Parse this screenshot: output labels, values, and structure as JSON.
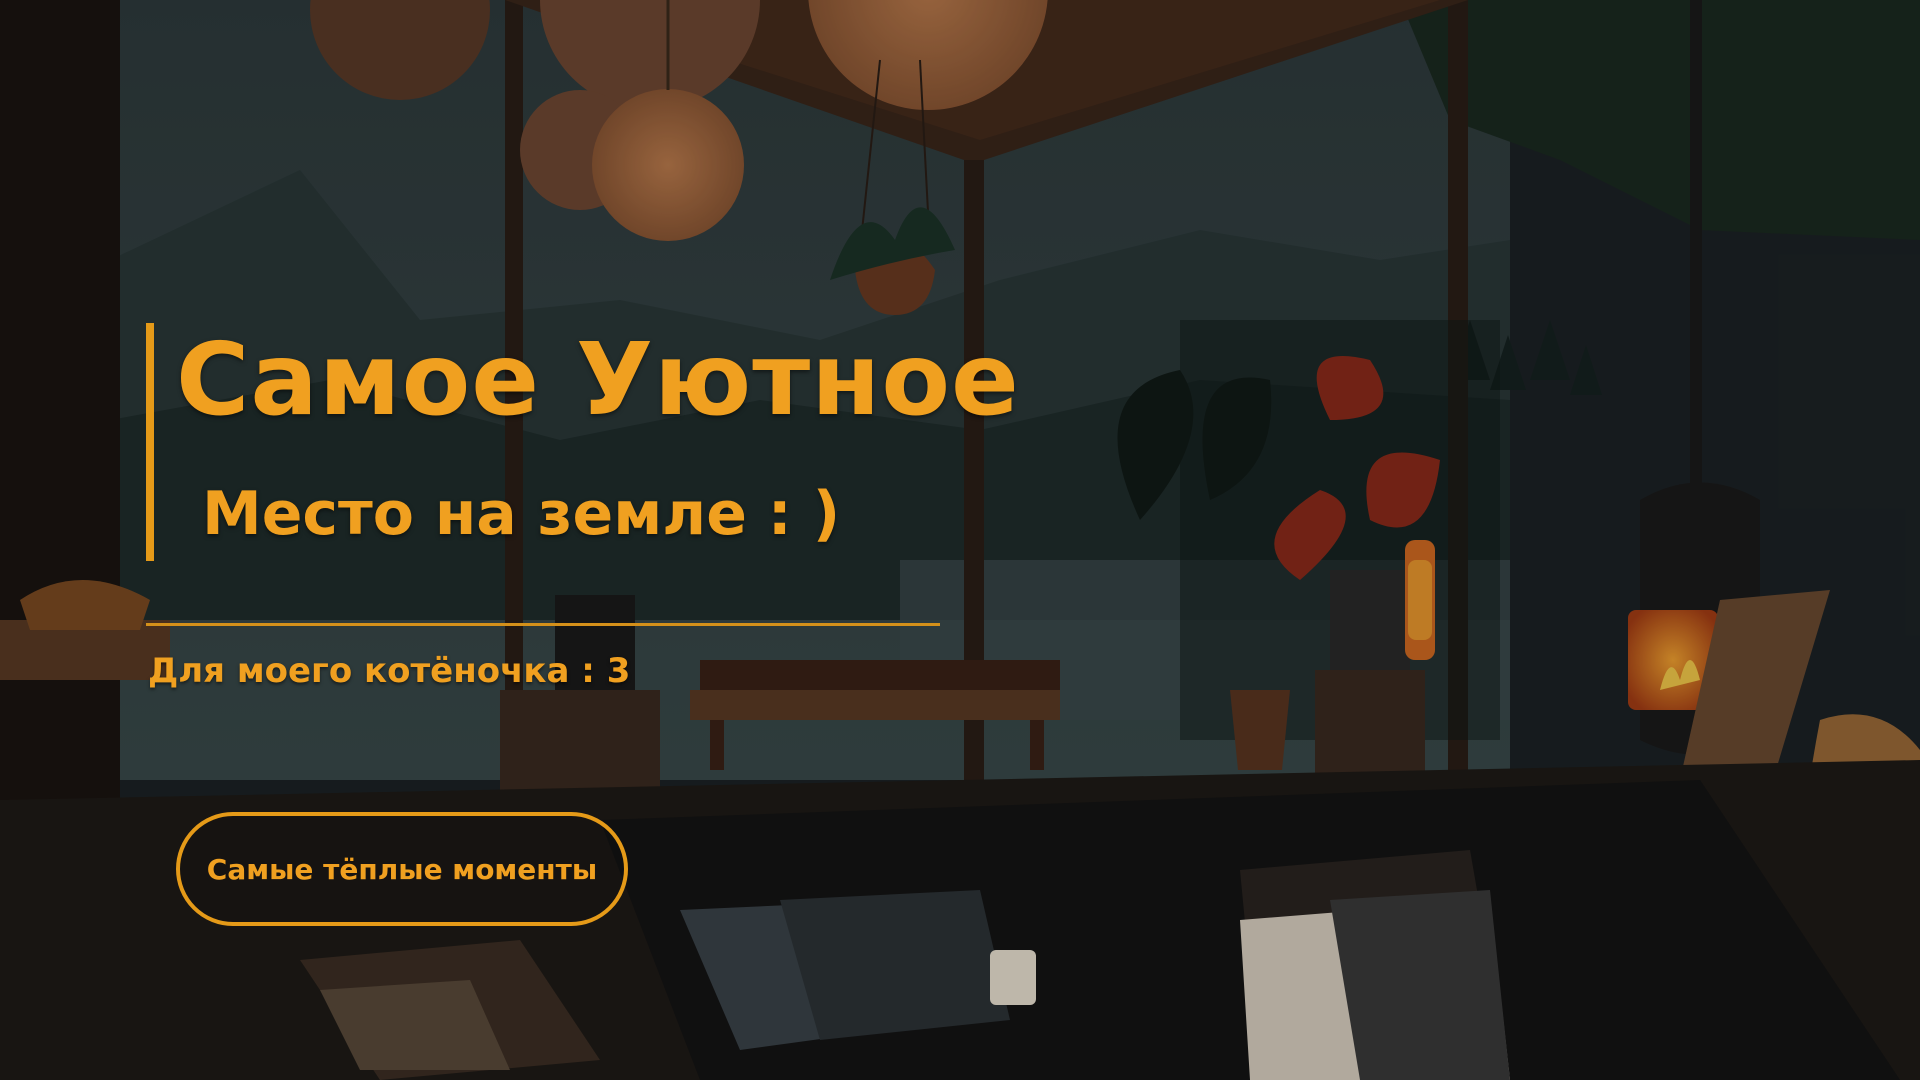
{
  "hero": {
    "title": "Самое Уютное",
    "subtitle": "Место на земле : )",
    "dedication": "Для моего котёночка : 3",
    "cta_label": "Самые тёплые моменты"
  },
  "colors": {
    "accent": "#f0a020",
    "accent_line": "#e59a18",
    "background": "#1a1f22"
  }
}
